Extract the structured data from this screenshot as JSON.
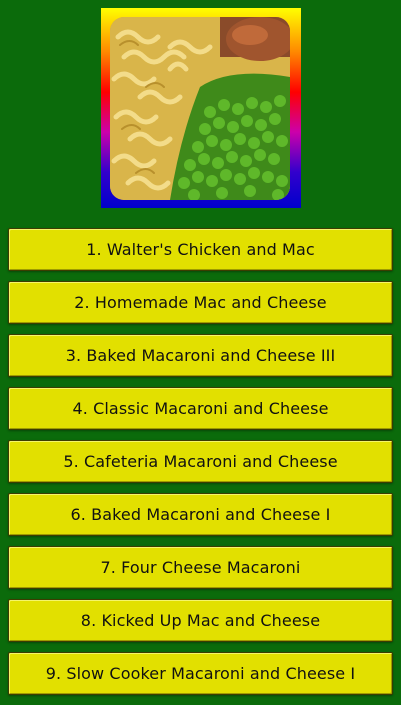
{
  "hero": {
    "image": "mac-and-cheese-with-peas-photo",
    "frame_colors": [
      "#ffff00",
      "#ff8800",
      "#ff0000",
      "#cc00aa",
      "#0000cc"
    ]
  },
  "recipes": [
    "1. Walter's Chicken and Mac",
    "2. Homemade Mac and Cheese",
    "3. Baked Macaroni and Cheese III",
    "4. Classic Macaroni and Cheese",
    "5. Cafeteria Macaroni and Cheese",
    "6. Baked Macaroni and Cheese I",
    "7. Four Cheese Macaroni",
    "8. Kicked Up Mac and Cheese",
    "9. Slow Cooker Macaroni and Cheese I"
  ],
  "colors": {
    "background": "#0b6b0b",
    "button": "#e2e000",
    "button_text": "#111111"
  }
}
